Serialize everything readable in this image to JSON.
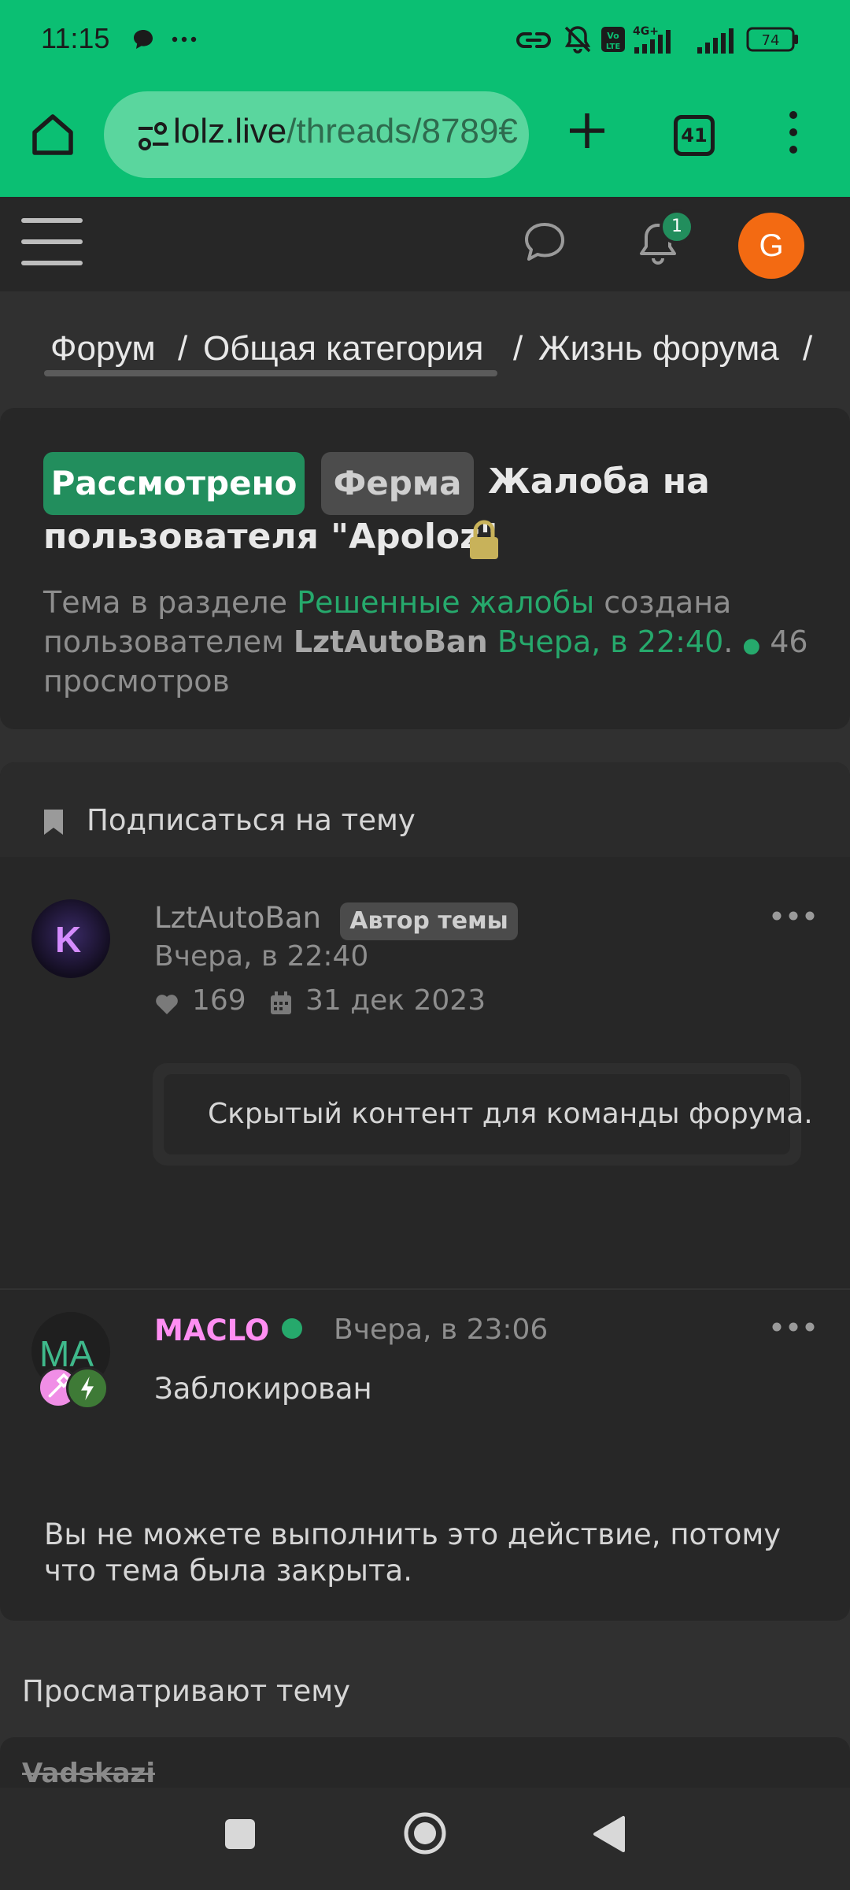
{
  "status_bar": {
    "time": "11:15",
    "battery": "74",
    "network": "4G+"
  },
  "browser": {
    "url_domain": "lolz.live",
    "url_path": "/threads/8789€",
    "tab_count": "41"
  },
  "header": {
    "notification_count": "1",
    "avatar_letter": "G"
  },
  "breadcrumb": {
    "items": [
      "Форум",
      "Общая категория",
      "Жизнь форума"
    ],
    "separator": "/"
  },
  "thread": {
    "tag_status": "Рассмотрено",
    "tag_prefix": "Ферма",
    "title_line1": "Жалоба на",
    "title_line2": "пользователя \"Apoloz\"",
    "meta": {
      "p1": "Тема в разделе ",
      "section": "Решенные жалобы",
      "p2": " создана",
      "p3": "пользователем ",
      "author": "LztAutoBan",
      "date": "Вчера, в 22:40",
      "p4": ".",
      "views": " 46",
      "views_label": "просмотров"
    }
  },
  "subscribe_label": "Подписаться на тему",
  "posts": [
    {
      "avatar_letter": "K",
      "username": "LztAutoBan",
      "badge": "Автор темы",
      "date": "Вчера, в 22:40",
      "likes": "169",
      "register_date": "31 дек 2023",
      "content": "Скрытый контент для команды форума."
    },
    {
      "avatar_letters": "MA",
      "username": "MACLO",
      "date": "Вчера, в 23:06",
      "status": "Заблокирован"
    }
  ],
  "closed_notice": "Вы не можете выполнить это действие, потому что тема была закрыта.",
  "viewing": {
    "heading": "Просматривают тему",
    "users": [
      "Vadskazi"
    ]
  },
  "colors": {
    "browser_green": "#0bbf73",
    "accent_green": "#26a96c",
    "tag_green": "#228e5d",
    "username_pink": "#ff8ef2",
    "avatar_orange": "#f36a12",
    "background": "#303030",
    "card": "#272727"
  },
  "icons": {
    "status": [
      "chat-bubble-icon",
      "more-dots-icon",
      "link-icon",
      "bell-off-icon",
      "volte-icon",
      "signal-icon",
      "battery-icon"
    ],
    "browser": [
      "home-icon",
      "site-settings-icon",
      "new-tab-icon",
      "tabs-icon",
      "overflow-menu-icon"
    ],
    "site": [
      "hamburger-icon",
      "chat-icon",
      "bell-icon",
      "bookmark-icon",
      "heart-icon",
      "calendar-icon",
      "lock-icon"
    ]
  }
}
